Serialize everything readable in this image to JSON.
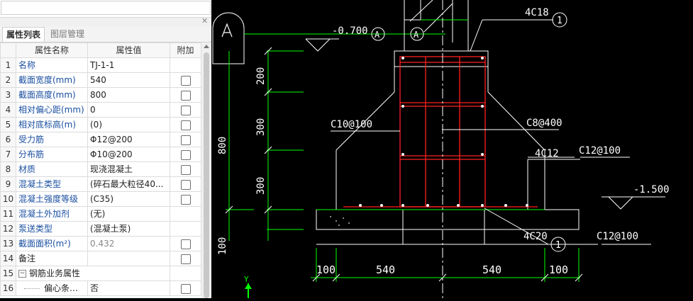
{
  "panel": {
    "search_value": "",
    "tabs": [
      {
        "label": "属性列表",
        "active": true
      },
      {
        "label": "图层管理",
        "active": false
      }
    ],
    "columns": {
      "name": "属性名称",
      "value": "属性值",
      "extra": "附加"
    },
    "rows": [
      {
        "num": "1",
        "name": "名称",
        "value": "TJ-1-1",
        "check": false
      },
      {
        "num": "2",
        "name": "截面宽度(mm)",
        "value": "540",
        "check": true
      },
      {
        "num": "3",
        "name": "截面高度(mm)",
        "value": "800",
        "check": true
      },
      {
        "num": "4",
        "name": "相对偏心距(mm)",
        "value": "0",
        "check": true
      },
      {
        "num": "5",
        "name": "相对底标高(m)",
        "value": "(0)",
        "check": true
      },
      {
        "num": "6",
        "name": "受力筋",
        "value": "Φ12@200",
        "check": true
      },
      {
        "num": "7",
        "name": "分布筋",
        "value": "Φ10@200",
        "check": true
      },
      {
        "num": "8",
        "name": "材质",
        "value": "现浇混凝土",
        "check": true
      },
      {
        "num": "9",
        "name": "混凝土类型",
        "value": "(碎石最大粒径40...",
        "check": true
      },
      {
        "num": "10",
        "name": "混凝土强度等级",
        "value": "(C35)",
        "check": true
      },
      {
        "num": "11",
        "name": "混凝土外加剂",
        "value": "(无)",
        "check": false
      },
      {
        "num": "12",
        "name": "泵送类型",
        "value": "(混凝土泵)",
        "check": false
      },
      {
        "num": "13",
        "name": "截面面积(m²)",
        "value": "0.432",
        "check": true,
        "grey": true
      },
      {
        "num": "14",
        "name": "备注",
        "value": "",
        "check": true,
        "black": true
      },
      {
        "num": "15",
        "name": "钢筋业务属性",
        "value": "",
        "check": false,
        "black": true,
        "group": true,
        "expander": "−"
      },
      {
        "num": "16",
        "name": "偏心条形...",
        "value": "否",
        "check": true,
        "black": true,
        "sub": true
      }
    ]
  },
  "drawing": {
    "grid_axis_label": "A",
    "level_top": "-0.700",
    "level_bottom": "-1.500",
    "section_mark": "A",
    "rebar_top": "4C18",
    "rebar_bottom": "4C20",
    "circle_top": "1",
    "circle_bottom": "1",
    "stirrup_left": "C10@100",
    "stirrup_right": "C8@400",
    "rebar_side": "4C12",
    "rebar_side2": "C12@100",
    "rebar_bottom_dist": "C12@100",
    "dim_v": [
      "200",
      "300",
      "300",
      "100"
    ],
    "dim_total": "800",
    "dim_h": [
      "100",
      "540",
      "540",
      "100"
    ],
    "axis_y": "Y",
    "colors": {
      "white": "#ffffff",
      "green": "#00ff00",
      "red": "#ff2020",
      "grey": "#b0b0b0",
      "bg": "#000000"
    }
  }
}
